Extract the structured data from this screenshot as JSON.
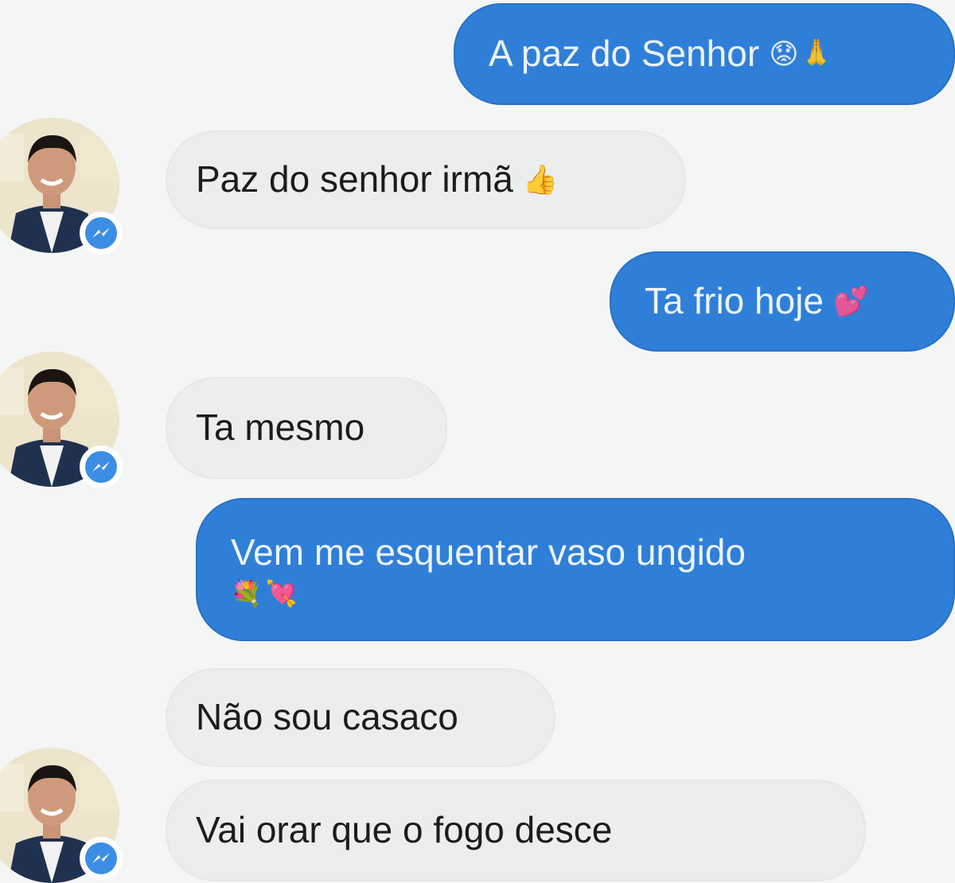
{
  "conversation": {
    "messages": [
      {
        "direction": "sent",
        "text": "A paz do Senhor",
        "emoji": "😟🙏",
        "emoji_icon": "sad-face-praying-hands-icon"
      },
      {
        "direction": "received",
        "text": "Paz do senhor irmã",
        "emoji": "👍",
        "emoji_icon": "thumbs-up-icon"
      },
      {
        "direction": "sent",
        "text": "Ta frio hoje",
        "emoji": "💕",
        "emoji_icon": "two-hearts-icon"
      },
      {
        "direction": "received",
        "text": "Ta mesmo"
      },
      {
        "direction": "sent",
        "text": "Vem me esquentar vaso ungido",
        "emoji": "💐💘",
        "emoji_icon": "flowers-hearts-icon"
      },
      {
        "direction": "received",
        "text": "Não sou casaco"
      },
      {
        "direction": "received",
        "text": "Vai orar que o fogo desce"
      }
    ]
  },
  "theme": {
    "sent_bubble": "#2f7fd8",
    "sent_text": "#ecf3fb",
    "received_bubble": "#eceeee",
    "received_text": "#1c1c1c",
    "background": "#f4f6f6",
    "messenger_badge": "#3b8ee4"
  }
}
